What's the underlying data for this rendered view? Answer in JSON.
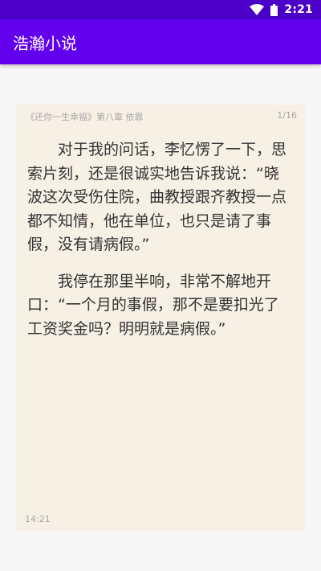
{
  "status_bar": {
    "time": "2:21",
    "icons": [
      "wifi-icon",
      "battery-icon"
    ]
  },
  "app_bar": {
    "title": "浩瀚小说"
  },
  "reader": {
    "chapter_title": "《还你一生幸福》第八章 依靠",
    "page_indicator": "1/16",
    "paragraphs": [
      "对于我的问话，李忆愣了一下，思索片刻，还是很诚实地告诉我说：“晓波这次受伤住院，曲教授跟齐教授一点都不知情，他在单位，也只是请了事假，没有请病假。”",
      "我停在那里半响，非常不解地开口：“一个月的事假，那不是要扣光了工资奖金吗？明明就是病假。”"
    ],
    "clock": "14:21"
  },
  "colors": {
    "status_bar": "#4a00c8",
    "app_bar": "#6200ee",
    "page_background": "#f7f0e5",
    "screen_background": "#f7f7f7"
  }
}
